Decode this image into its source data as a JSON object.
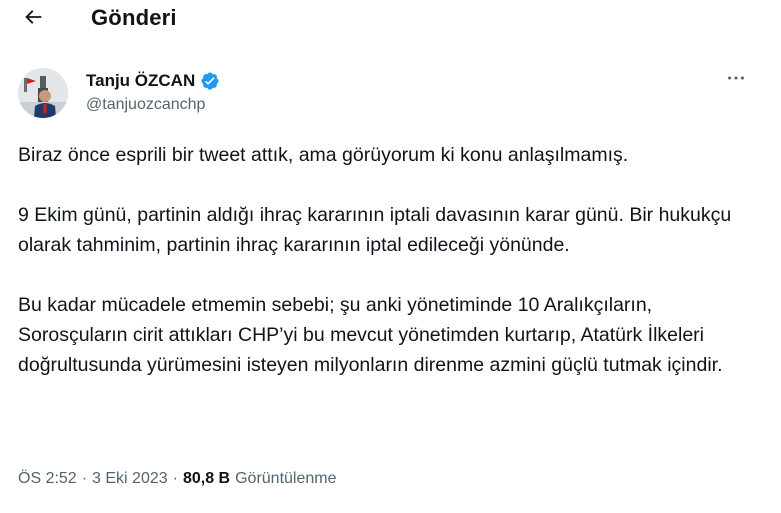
{
  "header": {
    "back_icon": "arrow-left-icon",
    "title": "Gönderi"
  },
  "author": {
    "name": "Tanju ÖZCAN",
    "handle": "@tanjuozcanchp",
    "verified_icon": "verified-badge-icon",
    "verified_color": "#1d9bf0"
  },
  "more_icon": "more-horizontal-icon",
  "tweet": {
    "paragraphs": [
      "Biraz önce esprili bir tweet attık, ama görüyorum ki konu anlaşılmamış.",
      "9 Ekim günü, partinin aldığı ihraç kararının iptali davasının karar günü. Bir hukukçu olarak tahminim, partinin ihraç kararının iptal edileceği yönünde.",
      "Bu kadar mücadele etmemin sebebi; şu anki yönetiminde 10 Aralıkçıların, Sorosçuların cirit attıkları CHP’yi bu mevcut yönetimden kurtarıp, Atatürk İlkeleri doğrultusunda yürümesini isteyen milyonların direnme azmini güçlü tutmak içindir."
    ]
  },
  "meta": {
    "time": "ÖS 2:52",
    "separator": "·",
    "date": "3 Eki 2023",
    "views_count": "80,8 B",
    "views_label": "Görüntülenme"
  }
}
